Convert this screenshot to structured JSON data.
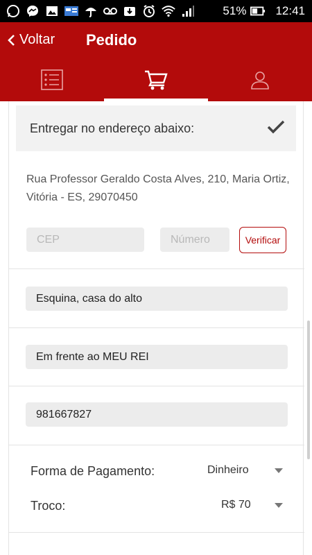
{
  "status_bar": {
    "battery": "51%",
    "time": "12:41",
    "icons": [
      "whatsapp-icon",
      "messenger-icon",
      "gallery-icon",
      "news-icon",
      "umbrella-icon",
      "voicemail-icon",
      "download-icon",
      "alarm-icon",
      "wifi-icon",
      "signal-icon",
      "battery-icon"
    ]
  },
  "app_bar": {
    "back_label": "Voltar",
    "title": "Pedido",
    "tabs": [
      {
        "icon": "list-icon",
        "active": false
      },
      {
        "icon": "cart-icon",
        "active": true
      },
      {
        "icon": "user-icon",
        "active": false
      }
    ],
    "color": "#b30b0b"
  },
  "delivery": {
    "option_label": "Entregar no endereço abaixo:",
    "checked": true,
    "address": "Rua Professor Geraldo Costa Alves, 210, Maria Ortiz, Vitória - ES, 29070450",
    "cep_placeholder": "CEP",
    "numero_placeholder": "Número",
    "verify_label": "Verificar",
    "complemento": "Esquina, casa do alto",
    "referencia": "Em frente ao MEU REI",
    "telefone": "981667827"
  },
  "payment": {
    "method_label": "Forma de Pagamento:",
    "method_value": "Dinheiro",
    "change_label": "Troco:",
    "change_value": "R$ 70"
  }
}
